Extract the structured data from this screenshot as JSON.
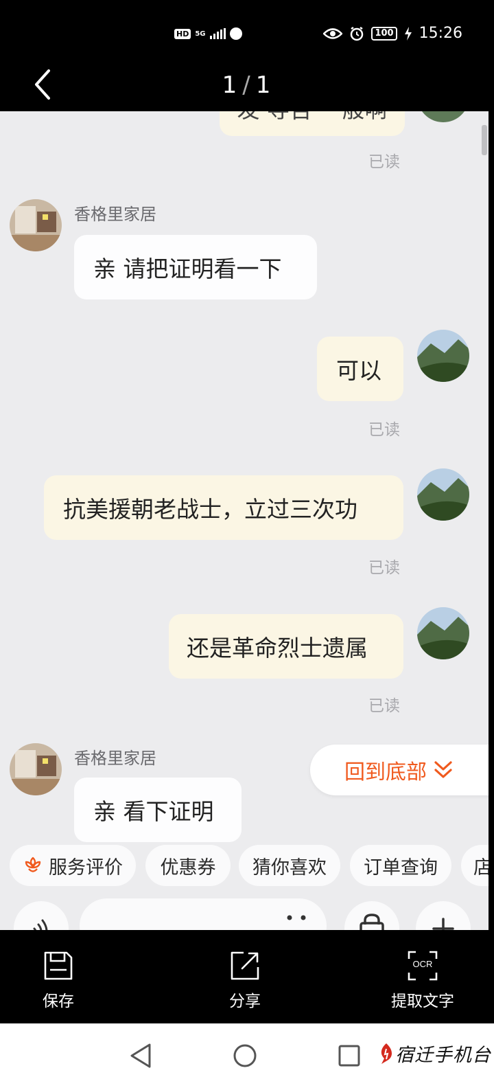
{
  "status_bar": {
    "hd": "HD",
    "network": "5G",
    "battery": "100",
    "time": "15:26"
  },
  "viewer": {
    "current_page": "1",
    "separator": "/",
    "total_pages": "1"
  },
  "chat": {
    "partial_top_message": "发 导告 一般啊",
    "read_label": "已读",
    "shop_name": "香格里家居",
    "messages": [
      {
        "side": "in",
        "text": "亲 请把证明看一下"
      },
      {
        "side": "out",
        "text": "可以"
      },
      {
        "side": "out",
        "text": "抗美援朝老战士，立过三次功"
      },
      {
        "side": "out",
        "text": "还是革命烈士遗属"
      },
      {
        "side": "in",
        "text": "亲 看下证明"
      }
    ],
    "back_to_bottom": "回到底部",
    "quick_actions": [
      "服务评价",
      "优惠券",
      "猜你喜欢",
      "订单查询",
      "店"
    ]
  },
  "actions": {
    "save": "保存",
    "share": "分享",
    "ocr_icon_text": "OCR",
    "extract_text": "提取文字"
  },
  "watermark": "宿迁手机台",
  "colors": {
    "accent_orange": "#f05a1e",
    "incoming_bubble": "#fdfdfe",
    "outgoing_bubble": "#fbf6e4",
    "chat_background": "#ececee"
  }
}
